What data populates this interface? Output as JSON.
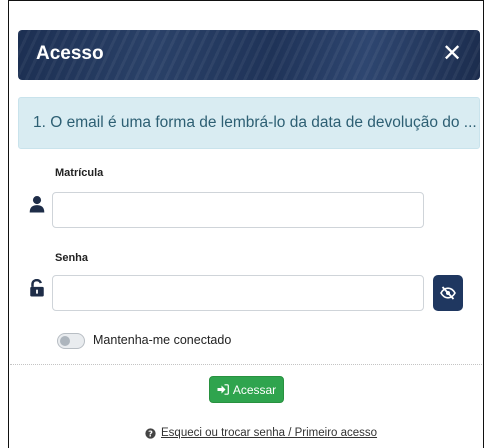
{
  "modal": {
    "title": "Acesso",
    "close_glyph": "✕"
  },
  "notice": {
    "text": "1. O email é uma forma de lembrá-lo da data de devolução do ..."
  },
  "form": {
    "matricula_label": "Matrícula",
    "matricula_value": "",
    "senha_label": "Senha",
    "senha_value": "",
    "remember_label": "Mantenha-me conectado",
    "remember_checked": false
  },
  "actions": {
    "submit_label": "Acessar",
    "help_link": "Esqueci ou trocar senha / Primeiro acesso"
  },
  "icons": {
    "user": "user-icon",
    "lock": "unlock-icon",
    "eye": "eye-slash-icon",
    "submit": "sign-in-icon",
    "help": "question-circle-icon"
  },
  "colors": {
    "header_bg": "#1f3358",
    "notice_bg": "#d9ecf2",
    "notice_text": "#2d5f73",
    "submit_bg": "#2fa44e",
    "eye_btn_bg": "#1f3760"
  }
}
